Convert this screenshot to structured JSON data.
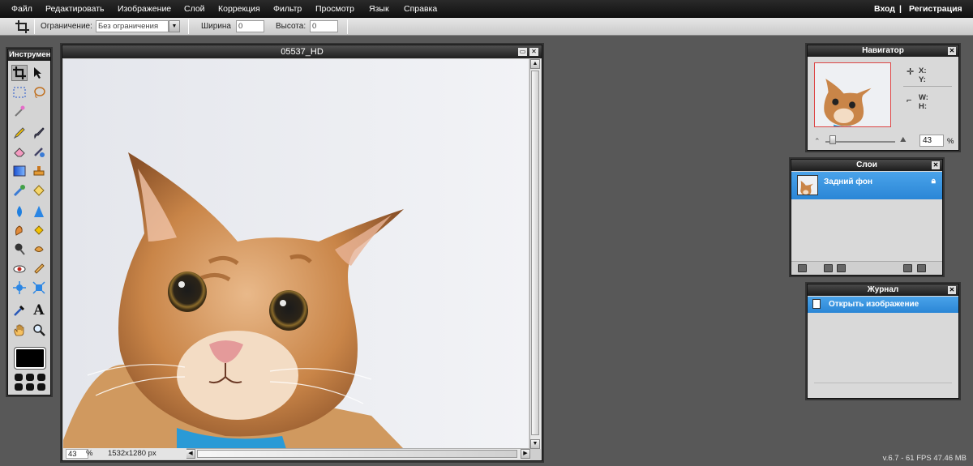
{
  "menubar": {
    "items": [
      {
        "label": "Файл"
      },
      {
        "label": "Редактировать"
      },
      {
        "label": "Изображение"
      },
      {
        "label": "Слой"
      },
      {
        "label": "Коррекция"
      },
      {
        "label": "Фильтр"
      },
      {
        "label": "Просмотр"
      },
      {
        "label": "Язык"
      },
      {
        "label": "Справка"
      }
    ],
    "login": "Вход",
    "separator": "|",
    "register": "Регистрация"
  },
  "options": {
    "constraint_label": "Ограничение:",
    "constraint_value": "Без ограничения",
    "width_label": "Ширина",
    "width_value": "0",
    "height_label": "Высота:",
    "height_value": "0"
  },
  "toolbox": {
    "title": "Инструменты",
    "tools": [
      "crop-icon",
      "move-icon",
      "marquee-icon",
      "lasso-icon",
      "wand-icon",
      "pencil-icon",
      "brush-icon",
      "eraser-icon",
      "replace-color-icon",
      "gradient-icon",
      "stamp-icon",
      "color-picker-icon",
      "fill-icon",
      "blur-icon",
      "sharpen-icon",
      "smudge-icon",
      "sponge-icon",
      "dodge-icon",
      "burn-icon",
      "redeye-icon",
      "spot-heal-icon",
      "bloat-icon",
      "pinch-icon",
      "picker-icon",
      "text-icon",
      "hand-icon",
      "zoom-icon"
    ],
    "foreground_color": "#000000"
  },
  "image_window": {
    "title": "05537_HD",
    "zoom": "43",
    "zoom_unit": "%",
    "dimensions": "1532x1280 px"
  },
  "navigator": {
    "title": "Навигатор",
    "x_label": "X:",
    "y_label": "Y:",
    "w_label": "W:",
    "h_label": "H:",
    "zoom_value": "43",
    "zoom_unit": "%",
    "zoom_level": 0.43
  },
  "layers": {
    "title": "Слои",
    "items": [
      {
        "name": "Задний фон",
        "locked": true
      }
    ]
  },
  "history": {
    "title": "Журнал",
    "items": [
      {
        "label": "Открыть изображение"
      }
    ]
  },
  "status": {
    "version": "v.6.7 - 61 FPS 47.46 MB"
  },
  "colors": {
    "selection_blue": "#2a86d6",
    "menubar_bg": "#1a1a1a",
    "workspace_bg": "#585858"
  }
}
